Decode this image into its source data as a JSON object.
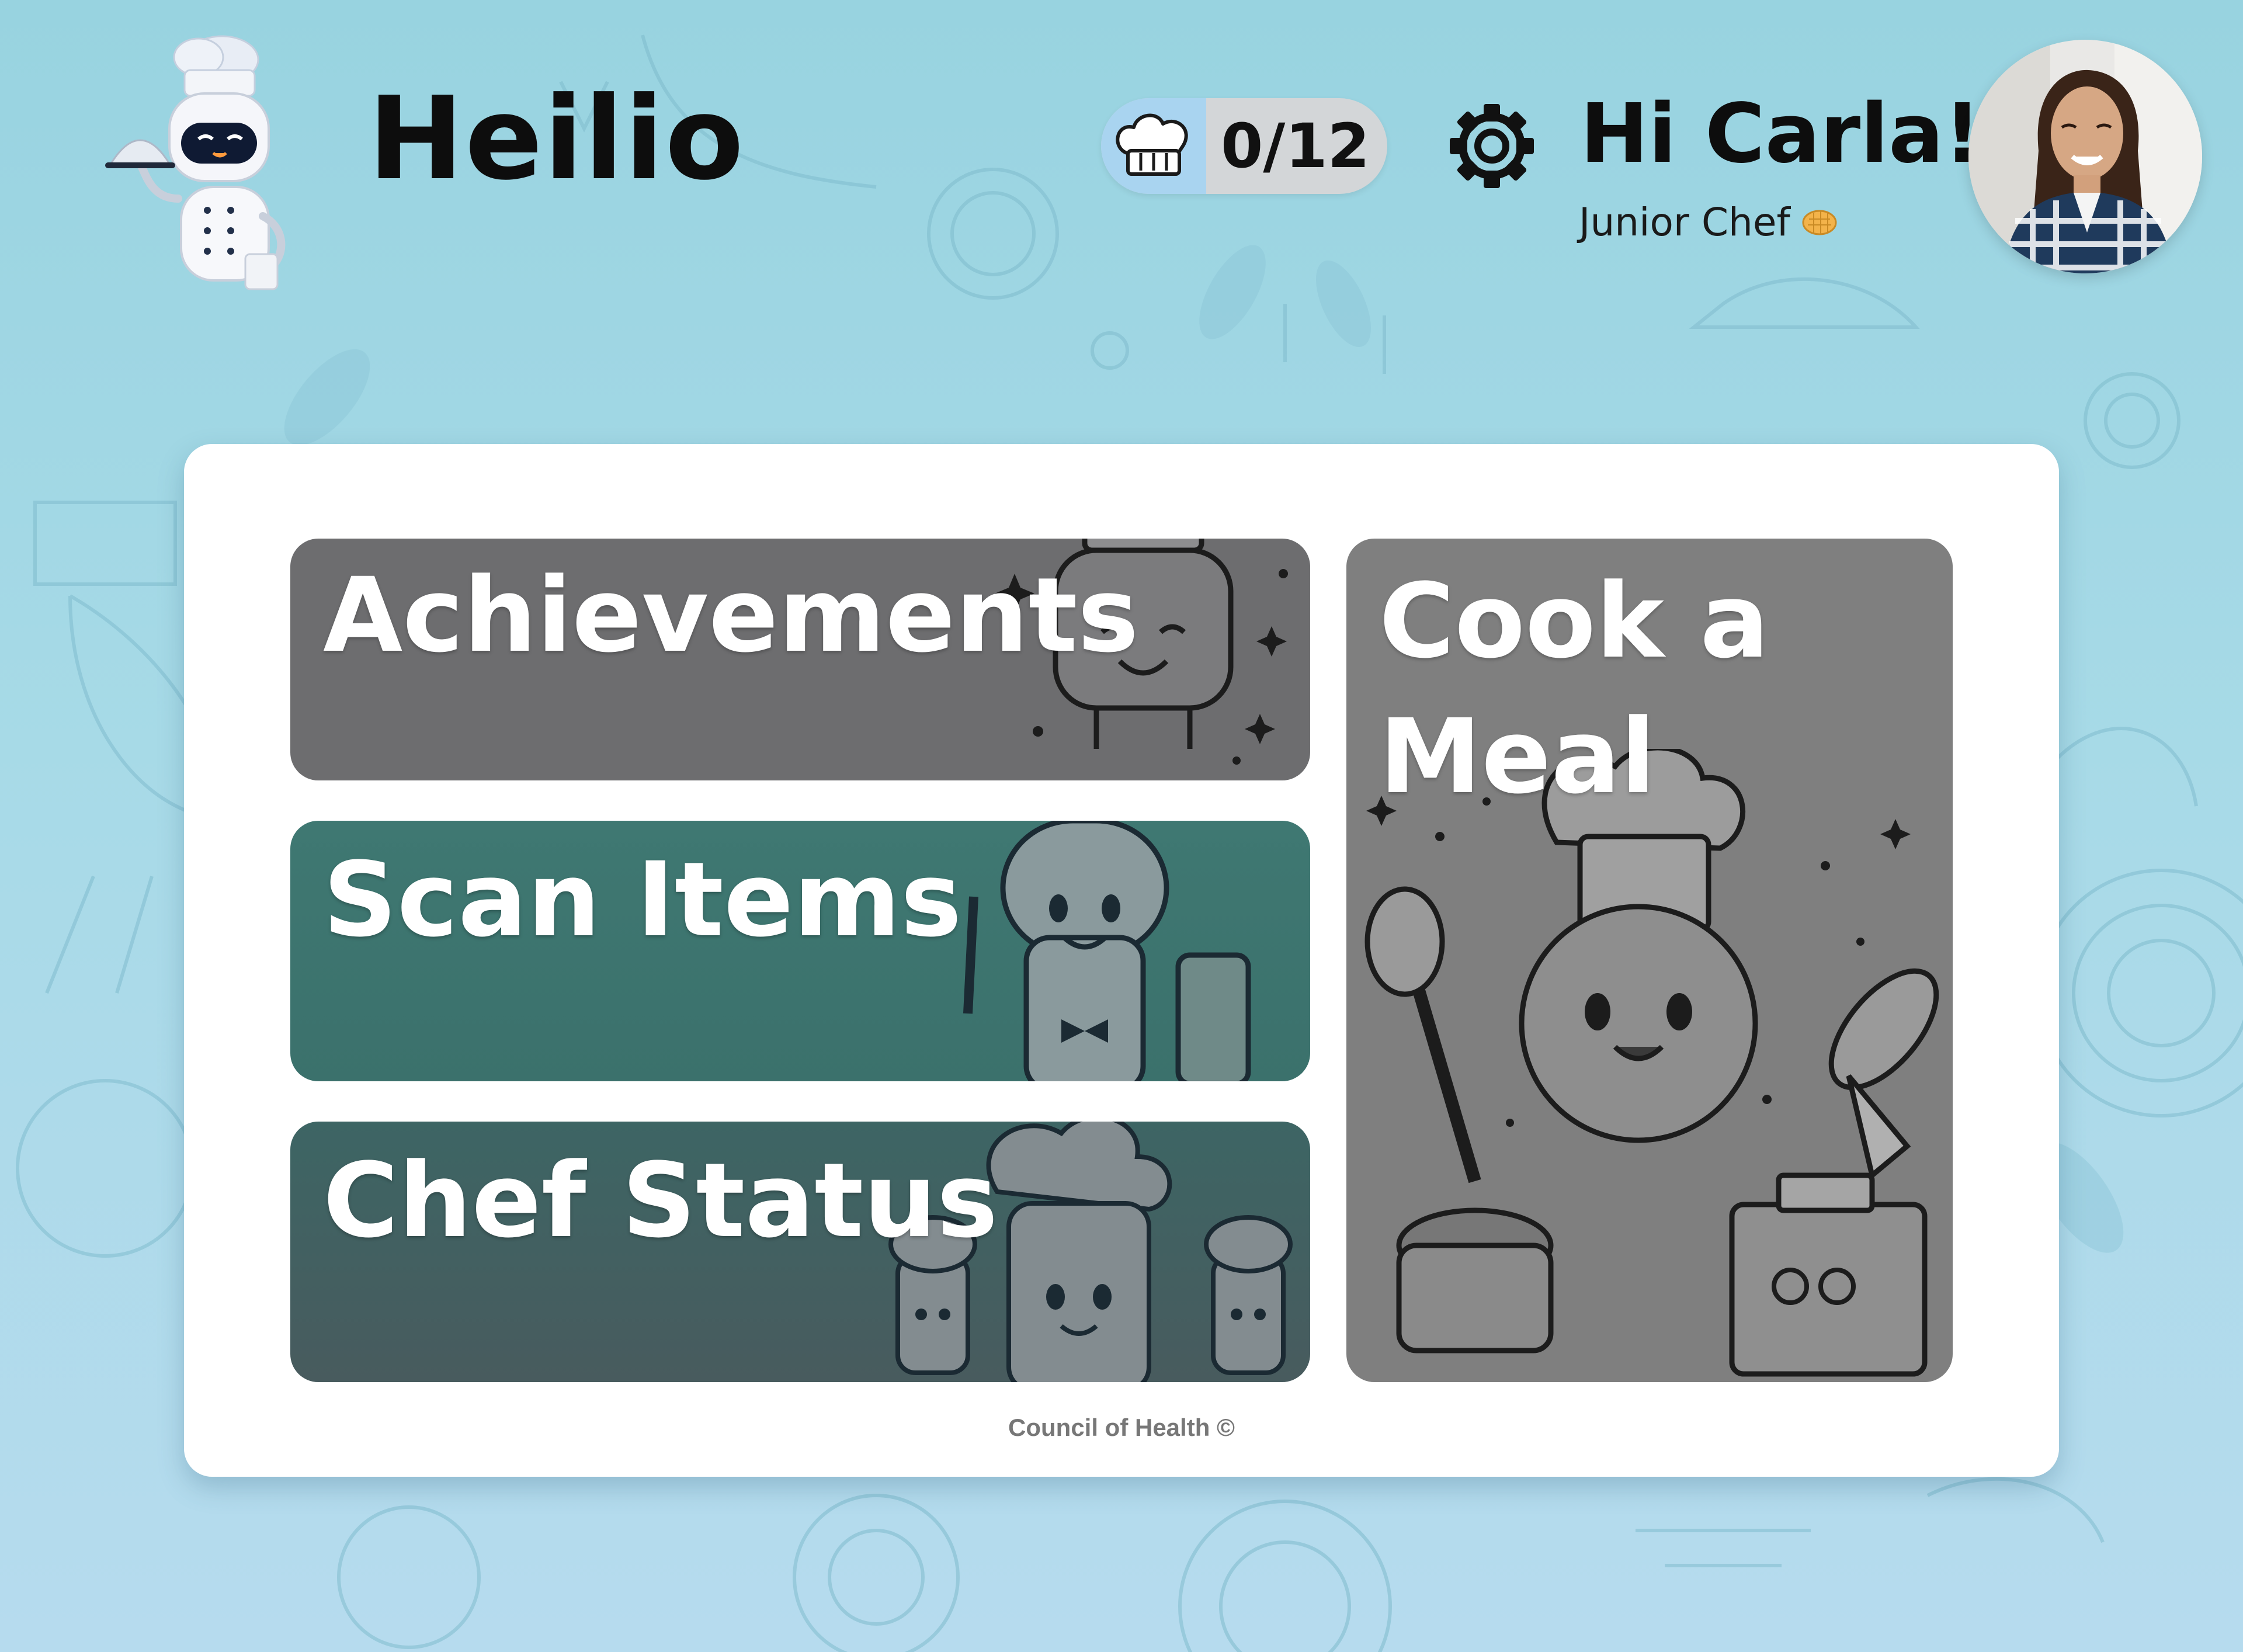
{
  "app": {
    "title": "Heilio"
  },
  "header": {
    "badge_count": "0/12",
    "greeting": "Hi Carla!",
    "rank": "Junior Chef",
    "settings_icon": "gear-icon",
    "badge_icon": "chef-hat-icon"
  },
  "tiles": {
    "achievements": "Achievements",
    "scan": "Scan Items",
    "chef_status": "Chef Status",
    "cook": "Cook a Meal"
  },
  "footer": "Council of Health ©",
  "colors": {
    "background": "#a7dae7",
    "card": "#ffffff",
    "achievements_tile": "#6d6d6f",
    "scan_tile": "#3f7872",
    "chef_status_tile": "#3d6564",
    "cook_tile": "#7f7f7f",
    "badge_highlight": "#a9d4f0"
  }
}
